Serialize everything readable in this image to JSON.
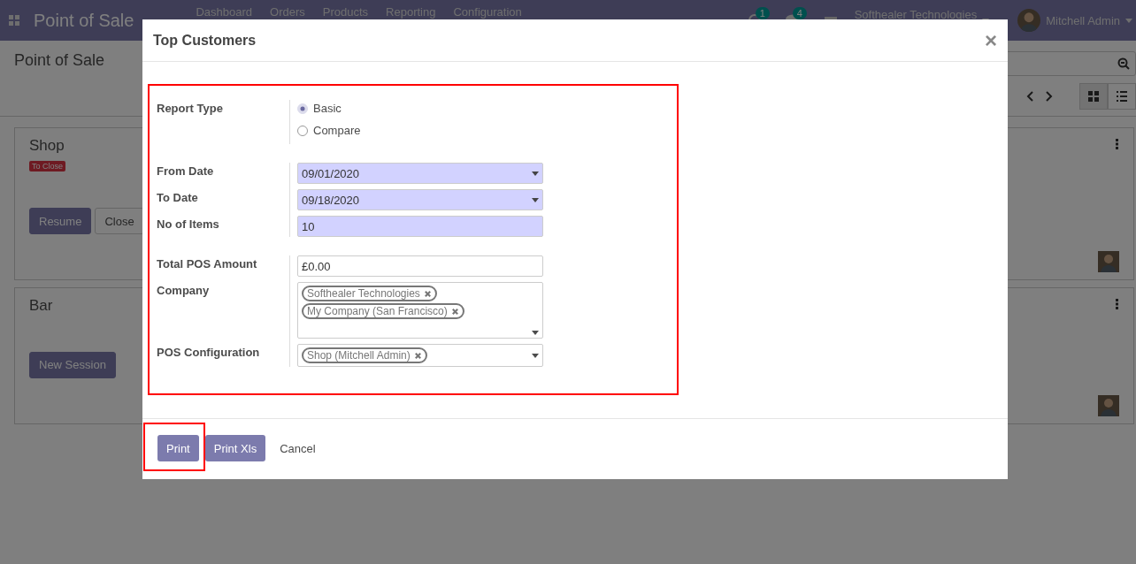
{
  "navbar": {
    "app_title": "Point of Sale",
    "menu": [
      "Dashboard",
      "Orders",
      "Products",
      "Reporting",
      "Configuration"
    ],
    "activity_count": "1",
    "message_count": "4",
    "company": "Softhealer Technologies",
    "user": "Mitchell Admin"
  },
  "control_panel": {
    "breadcrumb": "Point of Sale",
    "views": [
      {
        "kind": "kanban",
        "selected": true
      },
      {
        "kind": "list",
        "selected": false
      }
    ]
  },
  "cards": [
    {
      "name": "Shop",
      "status": "To Close",
      "buttons": [
        {
          "label": "Resume",
          "kind": "primary"
        },
        {
          "label": "Close",
          "kind": "secondary"
        }
      ]
    },
    {
      "name": "Bar",
      "buttons": [
        {
          "label": "New Session",
          "kind": "primary"
        }
      ]
    }
  ],
  "dialog": {
    "title": "Top Customers",
    "close": "×",
    "form_highlighted": true,
    "groups": [
      {
        "fields": [
          {
            "kind": "radio",
            "label": "Report Type",
            "options": [
              {
                "label": "Basic",
                "selected": true
              },
              {
                "label": "Compare",
                "selected": false
              }
            ]
          }
        ]
      },
      {
        "fields": [
          {
            "kind": "date",
            "label": "From Date",
            "value": "09/01/2020",
            "required": true
          },
          {
            "kind": "date",
            "label": "To Date",
            "value": "09/18/2020",
            "required": true
          },
          {
            "kind": "text",
            "label": "No of Items",
            "value": "10",
            "required": true
          }
        ]
      },
      {
        "fields": [
          {
            "kind": "text",
            "label": "Total POS Amount",
            "value": "£0.00",
            "required": false
          },
          {
            "kind": "tags",
            "label": "Company",
            "tags": [
              "Softhealer Technologies",
              "My Company (San Francisco)"
            ],
            "stacked": true
          },
          {
            "kind": "tags",
            "label": "POS Configuration",
            "tags": [
              "Shop (Mitchell Admin)"
            ],
            "stacked": false
          }
        ]
      }
    ],
    "buttons": [
      {
        "label": "Print",
        "kind": "primary",
        "highlighted": true
      },
      {
        "label": "Print Xls",
        "kind": "primary",
        "highlighted": false
      },
      {
        "label": "Cancel",
        "kind": "link",
        "highlighted": false
      }
    ]
  }
}
